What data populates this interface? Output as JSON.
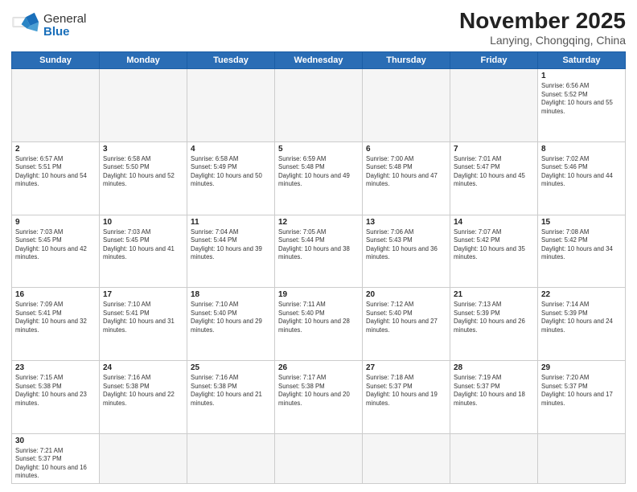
{
  "header": {
    "logo": {
      "general": "General",
      "blue": "Blue"
    },
    "title": "November 2025",
    "location": "Lanying, Chongqing, China"
  },
  "days_of_week": [
    "Sunday",
    "Monday",
    "Tuesday",
    "Wednesday",
    "Thursday",
    "Friday",
    "Saturday"
  ],
  "weeks": [
    [
      {
        "day": null,
        "empty": true
      },
      {
        "day": null,
        "empty": true
      },
      {
        "day": null,
        "empty": true
      },
      {
        "day": null,
        "empty": true
      },
      {
        "day": null,
        "empty": true
      },
      {
        "day": null,
        "empty": true
      },
      {
        "day": 1,
        "sunrise": "6:56 AM",
        "sunset": "5:52 PM",
        "daylight": "10 hours and 55 minutes."
      }
    ],
    [
      {
        "day": 2,
        "sunrise": "6:57 AM",
        "sunset": "5:51 PM",
        "daylight": "10 hours and 54 minutes."
      },
      {
        "day": 3,
        "sunrise": "6:58 AM",
        "sunset": "5:50 PM",
        "daylight": "10 hours and 52 minutes."
      },
      {
        "day": 4,
        "sunrise": "6:58 AM",
        "sunset": "5:49 PM",
        "daylight": "10 hours and 50 minutes."
      },
      {
        "day": 5,
        "sunrise": "6:59 AM",
        "sunset": "5:48 PM",
        "daylight": "10 hours and 49 minutes."
      },
      {
        "day": 6,
        "sunrise": "7:00 AM",
        "sunset": "5:48 PM",
        "daylight": "10 hours and 47 minutes."
      },
      {
        "day": 7,
        "sunrise": "7:01 AM",
        "sunset": "5:47 PM",
        "daylight": "10 hours and 45 minutes."
      },
      {
        "day": 8,
        "sunrise": "7:02 AM",
        "sunset": "5:46 PM",
        "daylight": "10 hours and 44 minutes."
      }
    ],
    [
      {
        "day": 9,
        "sunrise": "7:03 AM",
        "sunset": "5:45 PM",
        "daylight": "10 hours and 42 minutes."
      },
      {
        "day": 10,
        "sunrise": "7:03 AM",
        "sunset": "5:45 PM",
        "daylight": "10 hours and 41 minutes."
      },
      {
        "day": 11,
        "sunrise": "7:04 AM",
        "sunset": "5:44 PM",
        "daylight": "10 hours and 39 minutes."
      },
      {
        "day": 12,
        "sunrise": "7:05 AM",
        "sunset": "5:44 PM",
        "daylight": "10 hours and 38 minutes."
      },
      {
        "day": 13,
        "sunrise": "7:06 AM",
        "sunset": "5:43 PM",
        "daylight": "10 hours and 36 minutes."
      },
      {
        "day": 14,
        "sunrise": "7:07 AM",
        "sunset": "5:42 PM",
        "daylight": "10 hours and 35 minutes."
      },
      {
        "day": 15,
        "sunrise": "7:08 AM",
        "sunset": "5:42 PM",
        "daylight": "10 hours and 34 minutes."
      }
    ],
    [
      {
        "day": 16,
        "sunrise": "7:09 AM",
        "sunset": "5:41 PM",
        "daylight": "10 hours and 32 minutes."
      },
      {
        "day": 17,
        "sunrise": "7:10 AM",
        "sunset": "5:41 PM",
        "daylight": "10 hours and 31 minutes."
      },
      {
        "day": 18,
        "sunrise": "7:10 AM",
        "sunset": "5:40 PM",
        "daylight": "10 hours and 29 minutes."
      },
      {
        "day": 19,
        "sunrise": "7:11 AM",
        "sunset": "5:40 PM",
        "daylight": "10 hours and 28 minutes."
      },
      {
        "day": 20,
        "sunrise": "7:12 AM",
        "sunset": "5:40 PM",
        "daylight": "10 hours and 27 minutes."
      },
      {
        "day": 21,
        "sunrise": "7:13 AM",
        "sunset": "5:39 PM",
        "daylight": "10 hours and 26 minutes."
      },
      {
        "day": 22,
        "sunrise": "7:14 AM",
        "sunset": "5:39 PM",
        "daylight": "10 hours and 24 minutes."
      }
    ],
    [
      {
        "day": 23,
        "sunrise": "7:15 AM",
        "sunset": "5:38 PM",
        "daylight": "10 hours and 23 minutes."
      },
      {
        "day": 24,
        "sunrise": "7:16 AM",
        "sunset": "5:38 PM",
        "daylight": "10 hours and 22 minutes."
      },
      {
        "day": 25,
        "sunrise": "7:16 AM",
        "sunset": "5:38 PM",
        "daylight": "10 hours and 21 minutes."
      },
      {
        "day": 26,
        "sunrise": "7:17 AM",
        "sunset": "5:38 PM",
        "daylight": "10 hours and 20 minutes."
      },
      {
        "day": 27,
        "sunrise": "7:18 AM",
        "sunset": "5:37 PM",
        "daylight": "10 hours and 19 minutes."
      },
      {
        "day": 28,
        "sunrise": "7:19 AM",
        "sunset": "5:37 PM",
        "daylight": "10 hours and 18 minutes."
      },
      {
        "day": 29,
        "sunrise": "7:20 AM",
        "sunset": "5:37 PM",
        "daylight": "10 hours and 17 minutes."
      }
    ],
    [
      {
        "day": 30,
        "sunrise": "7:21 AM",
        "sunset": "5:37 PM",
        "daylight": "10 hours and 16 minutes."
      },
      {
        "day": null,
        "empty": true
      },
      {
        "day": null,
        "empty": true
      },
      {
        "day": null,
        "empty": true
      },
      {
        "day": null,
        "empty": true
      },
      {
        "day": null,
        "empty": true
      },
      {
        "day": null,
        "empty": true
      }
    ]
  ]
}
